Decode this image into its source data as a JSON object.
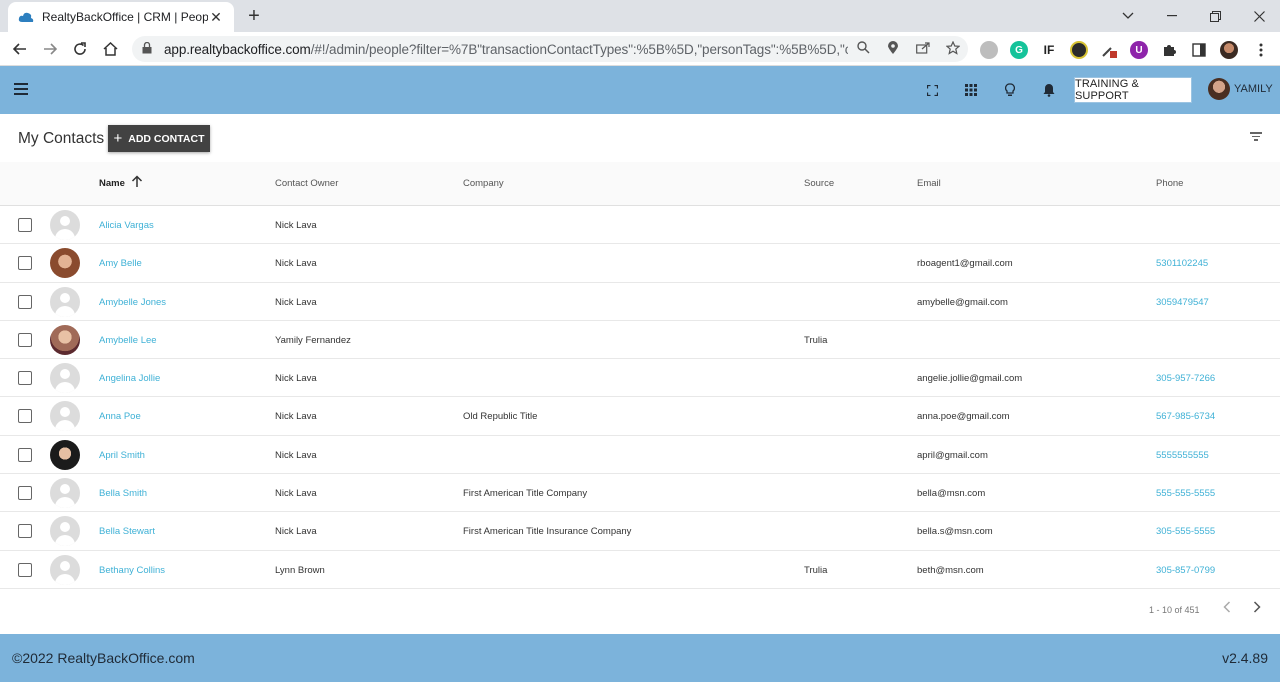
{
  "browser": {
    "tab_title": "RealtyBackOffice | CRM | People",
    "tab_close": "✕",
    "new_tab": "+",
    "url_host": "app.realtybackoffice.com",
    "url_path": "/#!/admin/people?filter=%7B\"transactionContactTypes\":%5B%5D,\"personTags\":%5B%5D,\"c..."
  },
  "header": {
    "training_label": "TRAINING & SUPPORT",
    "user_name": "YAMILY"
  },
  "page": {
    "title": "My Contacts",
    "add_button_label": "ADD CONTACT"
  },
  "table": {
    "columns": {
      "name": "Name",
      "owner": "Contact Owner",
      "company": "Company",
      "source": "Source",
      "email": "Email",
      "phone": "Phone"
    },
    "rows": [
      {
        "name": "Alicia Vargas",
        "owner": "Nick Lava",
        "company": "",
        "source": "",
        "email": "",
        "phone": "",
        "avatar": "blank"
      },
      {
        "name": "Amy Belle",
        "owner": "Nick Lava",
        "company": "",
        "source": "",
        "email": "rboagent1@gmail.com",
        "phone": "5301102245",
        "avatar": "photo1"
      },
      {
        "name": "Amybelle Jones",
        "owner": "Nick Lava",
        "company": "",
        "source": "",
        "email": "amybelle@gmail.com",
        "phone": "3059479547",
        "avatar": "blank"
      },
      {
        "name": "Amybelle Lee",
        "owner": "Yamily Fernandez",
        "company": "",
        "source": "Trulia",
        "email": "",
        "phone": "",
        "avatar": "photo2"
      },
      {
        "name": "Angelina Jollie",
        "owner": "Nick Lava",
        "company": "",
        "source": "",
        "email": "angelie.jollie@gmail.com",
        "phone": "305-957-7266",
        "avatar": "blank"
      },
      {
        "name": "Anna Poe",
        "owner": "Nick Lava",
        "company": "Old Republic Title",
        "source": "",
        "email": "anna.poe@gmail.com",
        "phone": "567-985-6734",
        "avatar": "blank"
      },
      {
        "name": "April Smith",
        "owner": "Nick Lava",
        "company": "",
        "source": "",
        "email": "april@gmail.com",
        "phone": "5555555555",
        "avatar": "photo3"
      },
      {
        "name": "Bella Smith",
        "owner": "Nick Lava",
        "company": "First American Title Company",
        "source": "",
        "email": "bella@msn.com",
        "phone": "555-555-5555",
        "avatar": "blank"
      },
      {
        "name": "Bella Stewart",
        "owner": "Nick Lava",
        "company": "First American Title Insurance Company",
        "source": "",
        "email": "bella.s@msn.com",
        "phone": "305-555-5555",
        "avatar": "blank"
      },
      {
        "name": "Bethany Collins",
        "owner": "Lynn Brown",
        "company": "",
        "source": "Trulia",
        "email": "beth@msn.com",
        "phone": "305-857-0799",
        "avatar": "blank"
      }
    ]
  },
  "pagination": {
    "range": "1 - 10 of 451"
  },
  "footer": {
    "copyright": "©2022 RealtyBackOffice.com",
    "version": "v2.4.89"
  },
  "colors": {
    "header_bg": "#7cb3db",
    "link": "#3fb1d6",
    "button_dark": "#424242"
  }
}
